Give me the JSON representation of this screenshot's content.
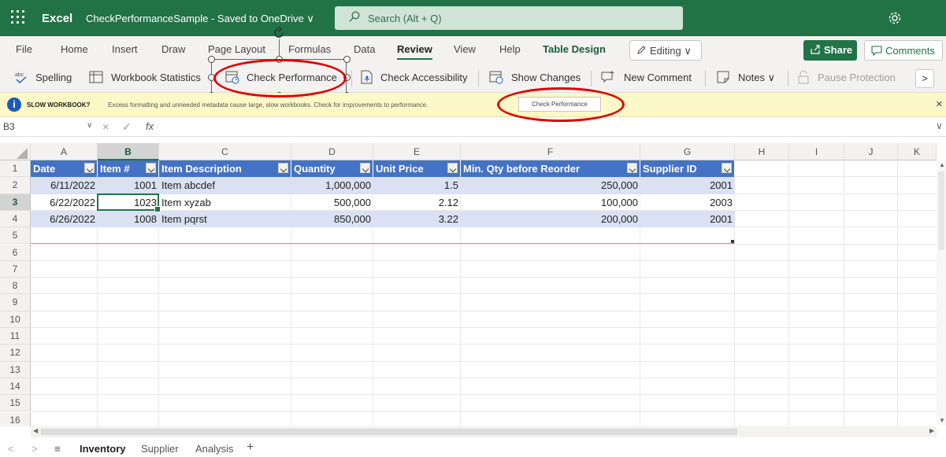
{
  "title_bar": {
    "app_name": "Excel",
    "document": "CheckPerformanceSample - Saved to OneDrive ∨",
    "search_placeholder": "Search (Alt + Q)",
    "icons": [
      "waffle-icon",
      "search-icon",
      "gear-icon"
    ]
  },
  "menu": {
    "tabs": [
      "File",
      "Home",
      "Insert",
      "Draw",
      "Page Layout",
      "Formulas",
      "Data",
      "Review",
      "View",
      "Help",
      "Table Design"
    ],
    "active_tab": "Review",
    "editing_label": "Editing ∨",
    "share_label": "Share",
    "comments_label": "Comments"
  },
  "ribbon": {
    "spelling": "Spelling",
    "workbook_statistics": "Workbook Statistics",
    "check_performance": "Check Performance",
    "check_accessibility": "Check Accessibility",
    "show_changes": "Show Changes",
    "new_comment": "New Comment",
    "notes": "Notes ∨",
    "pause_protection": "Pause Protection",
    "more": ">"
  },
  "warning": {
    "title": "SLOW WORKBOOK?",
    "message": "Excess formatting and unneeded metadata cause large, slow workbooks. Check for improvements to performance.",
    "button": "Check Performance",
    "close": "×"
  },
  "formula_bar": {
    "name_box": "B3",
    "cancel": "×",
    "enter": "✓",
    "fx": "fx",
    "value": ""
  },
  "grid": {
    "columns": [
      "A",
      "B",
      "C",
      "D",
      "E",
      "F",
      "G",
      "H",
      "I",
      "J",
      "K"
    ],
    "selected_column": "B",
    "rows": [
      "1",
      "2",
      "3",
      "4",
      "5",
      "6",
      "7",
      "8",
      "9",
      "10",
      "11",
      "12",
      "13",
      "14",
      "15",
      "16"
    ],
    "selected_row": "3",
    "table_headers": [
      "Date",
      "Item #",
      "Item Description",
      "Quantity",
      "Unit Price",
      "Min. Qty before Reorder",
      "Supplier ID"
    ],
    "table_rows": [
      [
        "6/11/2022",
        "1001",
        "Item abcdef",
        "1,000,000",
        "1.5",
        "250,000",
        "2001"
      ],
      [
        "6/22/2022",
        "1023",
        "Item xyzab",
        "500,000",
        "2.12",
        "100,000",
        "2003"
      ],
      [
        "6/26/2022",
        "1008",
        "Item pqrst",
        "850,000",
        "3.22",
        "200,000",
        "2001"
      ]
    ],
    "colors": {
      "header_fill": "#4472c4",
      "band_fill": "#d9e1f2",
      "selection": "#217346",
      "annotation": "#e00000"
    }
  },
  "sheets": {
    "tabs": [
      "Inventory",
      "Supplier",
      "Analysis"
    ],
    "active": "Inventory",
    "add": "+",
    "menu": "≡",
    "prev": "<",
    "next": ">"
  }
}
